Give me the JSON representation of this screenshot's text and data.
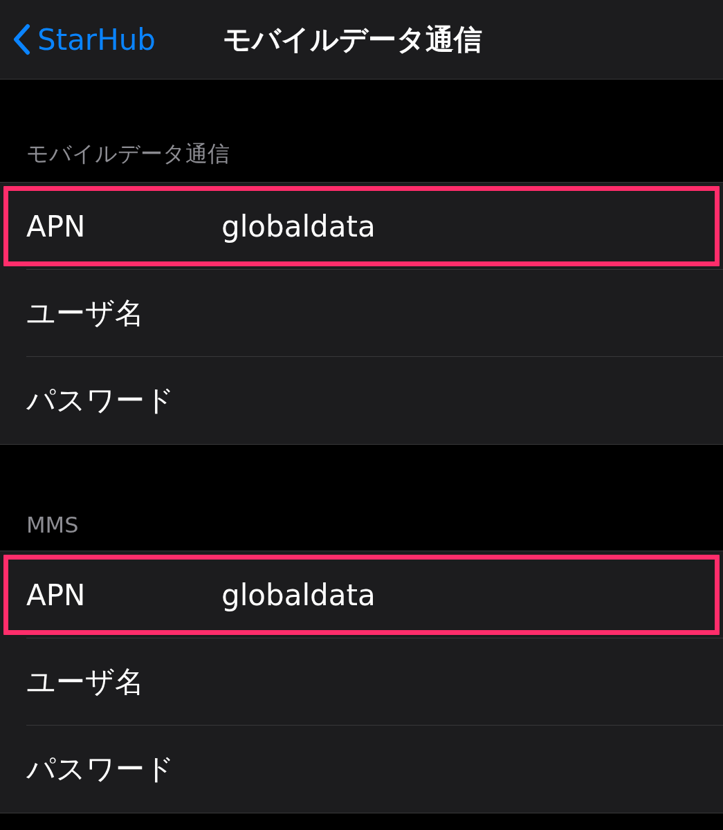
{
  "nav_bar": {
    "back_label": "StarHub",
    "title": "モバイルデータ通信"
  },
  "sections": [
    {
      "header": "モバイルデータ通信",
      "rows": [
        {
          "label": "APN",
          "value": "globaldata",
          "highlighted": true
        },
        {
          "label": "ユーザ名",
          "highlighted": false
        },
        {
          "label": "パスワード",
          "highlighted": false
        }
      ]
    },
    {
      "header": "MMS",
      "rows": [
        {
          "label": "APN",
          "value": "globaldata",
          "highlighted": true
        },
        {
          "label": "ユーザ名",
          "highlighted": false
        },
        {
          "label": "パスワード",
          "highlighted": false
        }
      ]
    }
  ]
}
